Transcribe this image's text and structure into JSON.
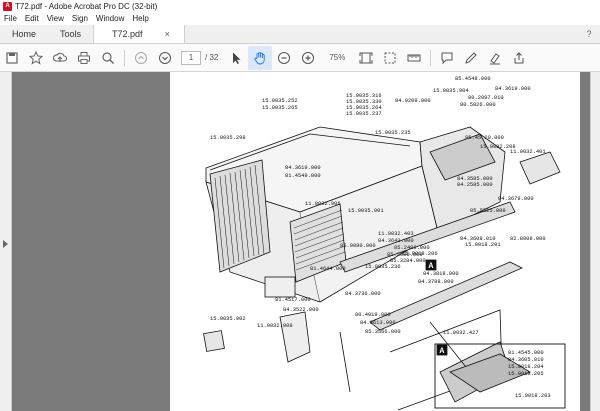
{
  "window": {
    "title": "T72.pdf - Adobe Acrobat Pro DC (32-bit)",
    "app_icon": "acrobat-icon"
  },
  "menu": [
    "File",
    "Edit",
    "View",
    "Sign",
    "Window",
    "Help"
  ],
  "tabs": {
    "home": "Home",
    "tools": "Tools",
    "document": "T72.pdf",
    "close": "×",
    "help": "?"
  },
  "toolbar": {
    "current_page": "1",
    "page_count": "/ 32",
    "zoom": "75%",
    "icons": [
      "save-icon",
      "bookmark-icon",
      "upload-icon",
      "print-icon",
      "search-icon",
      "page-up-icon",
      "page-down-icon",
      "select-icon",
      "hand-icon",
      "zoom-out-icon",
      "zoom-in-icon",
      "fit-icon",
      "marquee-icon",
      "ruler-icon",
      "comment-icon",
      "pen-icon",
      "highlight-icon",
      "share-icon"
    ]
  },
  "drawing": {
    "labels": [
      "15.0035.252",
      "15.0035.265",
      "15.0035.316",
      "15.0035.330",
      "15.0035.264",
      "15.0035.237",
      "15.0035.298",
      "15.0035.235",
      "85.4548.000",
      "84.3619.000",
      "84.9209.000",
      "15.0035.904",
      "80.2097.010",
      "80.5826.000",
      "85.45.20.000",
      "15.0032.208",
      "84.3619.000",
      "81.4549.000",
      "11.0032.906",
      "15.0035.901",
      "11.0032.401",
      "84.3679.000",
      "84.3585.000",
      "84.2585.000",
      "85.5525.000",
      "85.9080.000",
      "11.0032.403",
      "84.3643.000",
      "85.2488.000",
      "85.2080.000",
      "84.3608.010",
      "82.8008.000",
      "15.0018.201",
      "15.0035.236",
      "15.0018.206",
      "85.3284.000",
      "81.4644.000",
      "84.3736.000",
      "84.3818.000",
      "84.3788.000",
      "81.4517.000",
      "84.3522.000",
      "80.4019.000",
      "84.3613.000",
      "85.3566.000",
      "15.0035.902",
      "11.0032.908",
      "11.0032.427",
      "81.4545.000",
      "84.3605.010",
      "15.0018.204",
      "15.0018.205",
      "15.0018.203"
    ],
    "callout_a": "A"
  }
}
